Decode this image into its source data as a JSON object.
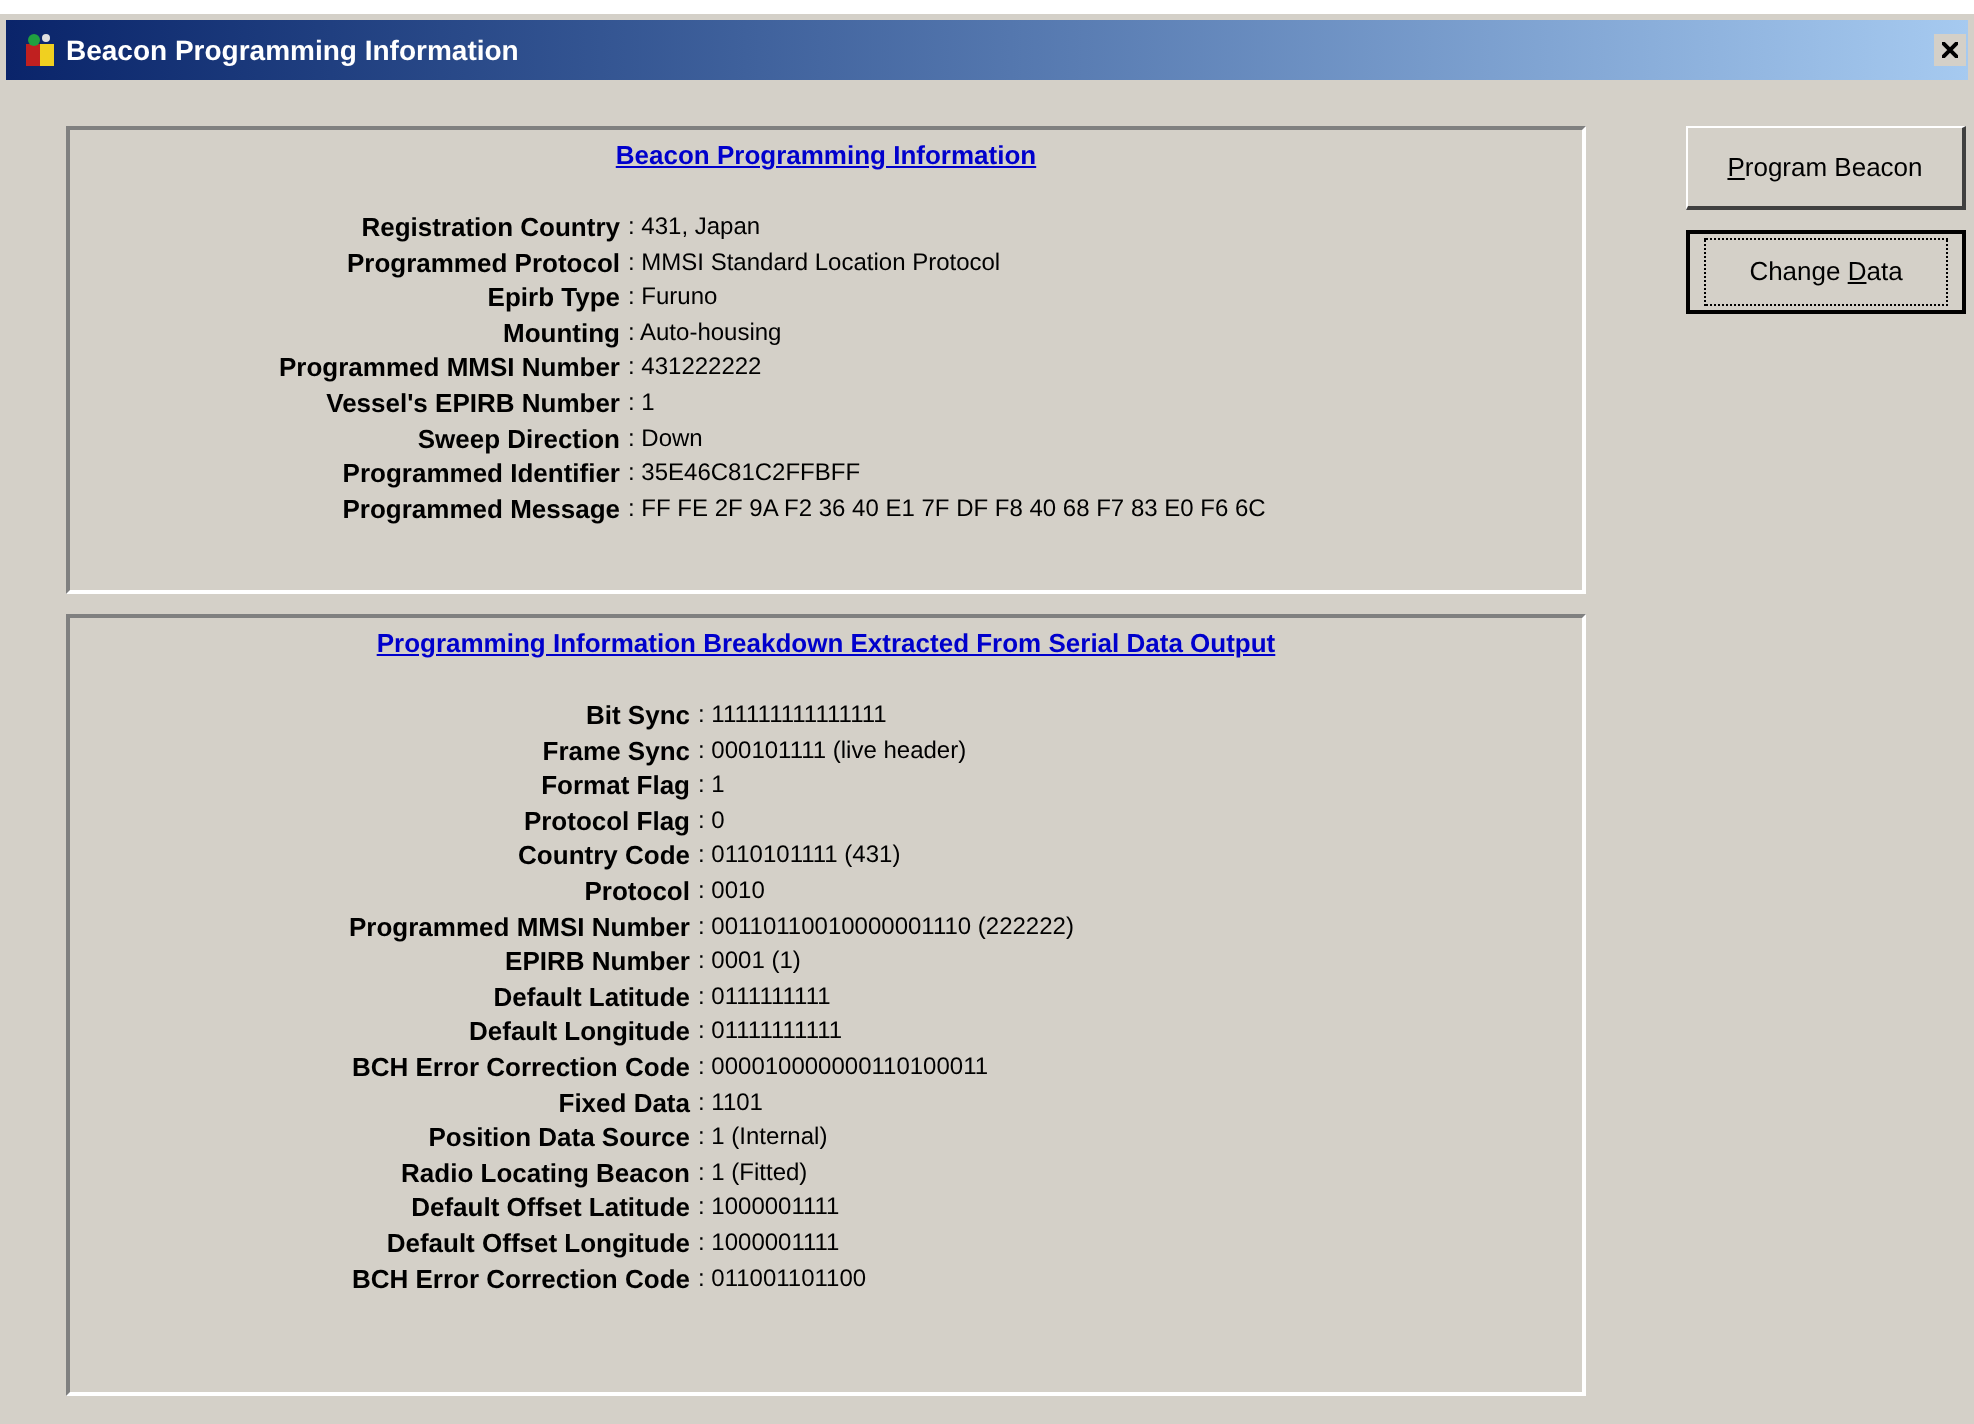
{
  "window": {
    "title": "Beacon Programming Information"
  },
  "panels": [
    {
      "heading": "Beacon Programming Information",
      "rows": [
        {
          "label": "Registration Country",
          "value": ": 431, Japan"
        },
        {
          "label": "Programmed Protocol",
          "value": ": MMSI Standard Location Protocol"
        },
        {
          "label": "Epirb Type",
          "value": ": Furuno"
        },
        {
          "label": "Mounting",
          "value": ": Auto-housing"
        },
        {
          "label": "Programmed MMSI Number",
          "value": ": 431222222"
        },
        {
          "label": "Vessel's EPIRB Number",
          "value": ": 1"
        },
        {
          "label": "Sweep Direction",
          "value": ": Down"
        },
        {
          "label": "Programmed Identifier",
          "value": ": 35E46C81C2FFBFF"
        },
        {
          "label": "Programmed Message",
          "value": ": FF FE 2F 9A F2 36 40 E1 7F DF F8 40 68 F7 83 E0 F6 6C"
        }
      ]
    },
    {
      "heading": "Programming Information Breakdown Extracted From Serial Data Output",
      "rows": [
        {
          "label": "Bit Sync",
          "value": ": 111111111111111"
        },
        {
          "label": "Frame Sync",
          "value": ": 000101111 (live header)"
        },
        {
          "label": "Format Flag",
          "value": ": 1"
        },
        {
          "label": "Protocol Flag",
          "value": ": 0"
        },
        {
          "label": "Country Code",
          "value": ": 0110101111 (431)"
        },
        {
          "label": "Protocol",
          "value": ": 0010"
        },
        {
          "label": "Programmed MMSI Number",
          "value": ": 00110110010000001110 (222222)"
        },
        {
          "label": "EPIRB Number",
          "value": ": 0001 (1)"
        },
        {
          "label": "Default Latitude",
          "value": ": 0111111111"
        },
        {
          "label": "Default Longitude",
          "value": ": 01111111111"
        },
        {
          "label": "BCH Error Correction Code",
          "value": ": 000010000000110100011"
        },
        {
          "label": "Fixed Data",
          "value": ": 1101"
        },
        {
          "label": "Position Data Source",
          "value": ": 1 (Internal)"
        },
        {
          "label": "Radio Locating Beacon",
          "value": ": 1 (Fitted)"
        },
        {
          "label": "Default Offset Latitude",
          "value": ": 1000001111"
        },
        {
          "label": "Default Offset Longitude",
          "value": ": 1000001111"
        },
        {
          "label": "BCH Error Correction Code",
          "value": ": 011001101100"
        }
      ]
    }
  ],
  "buttons": [
    {
      "key": "P",
      "after": "rogram Beacon",
      "focused": false
    },
    {
      "before": "Change ",
      "key": "D",
      "after": "ata",
      "focused": true
    }
  ]
}
